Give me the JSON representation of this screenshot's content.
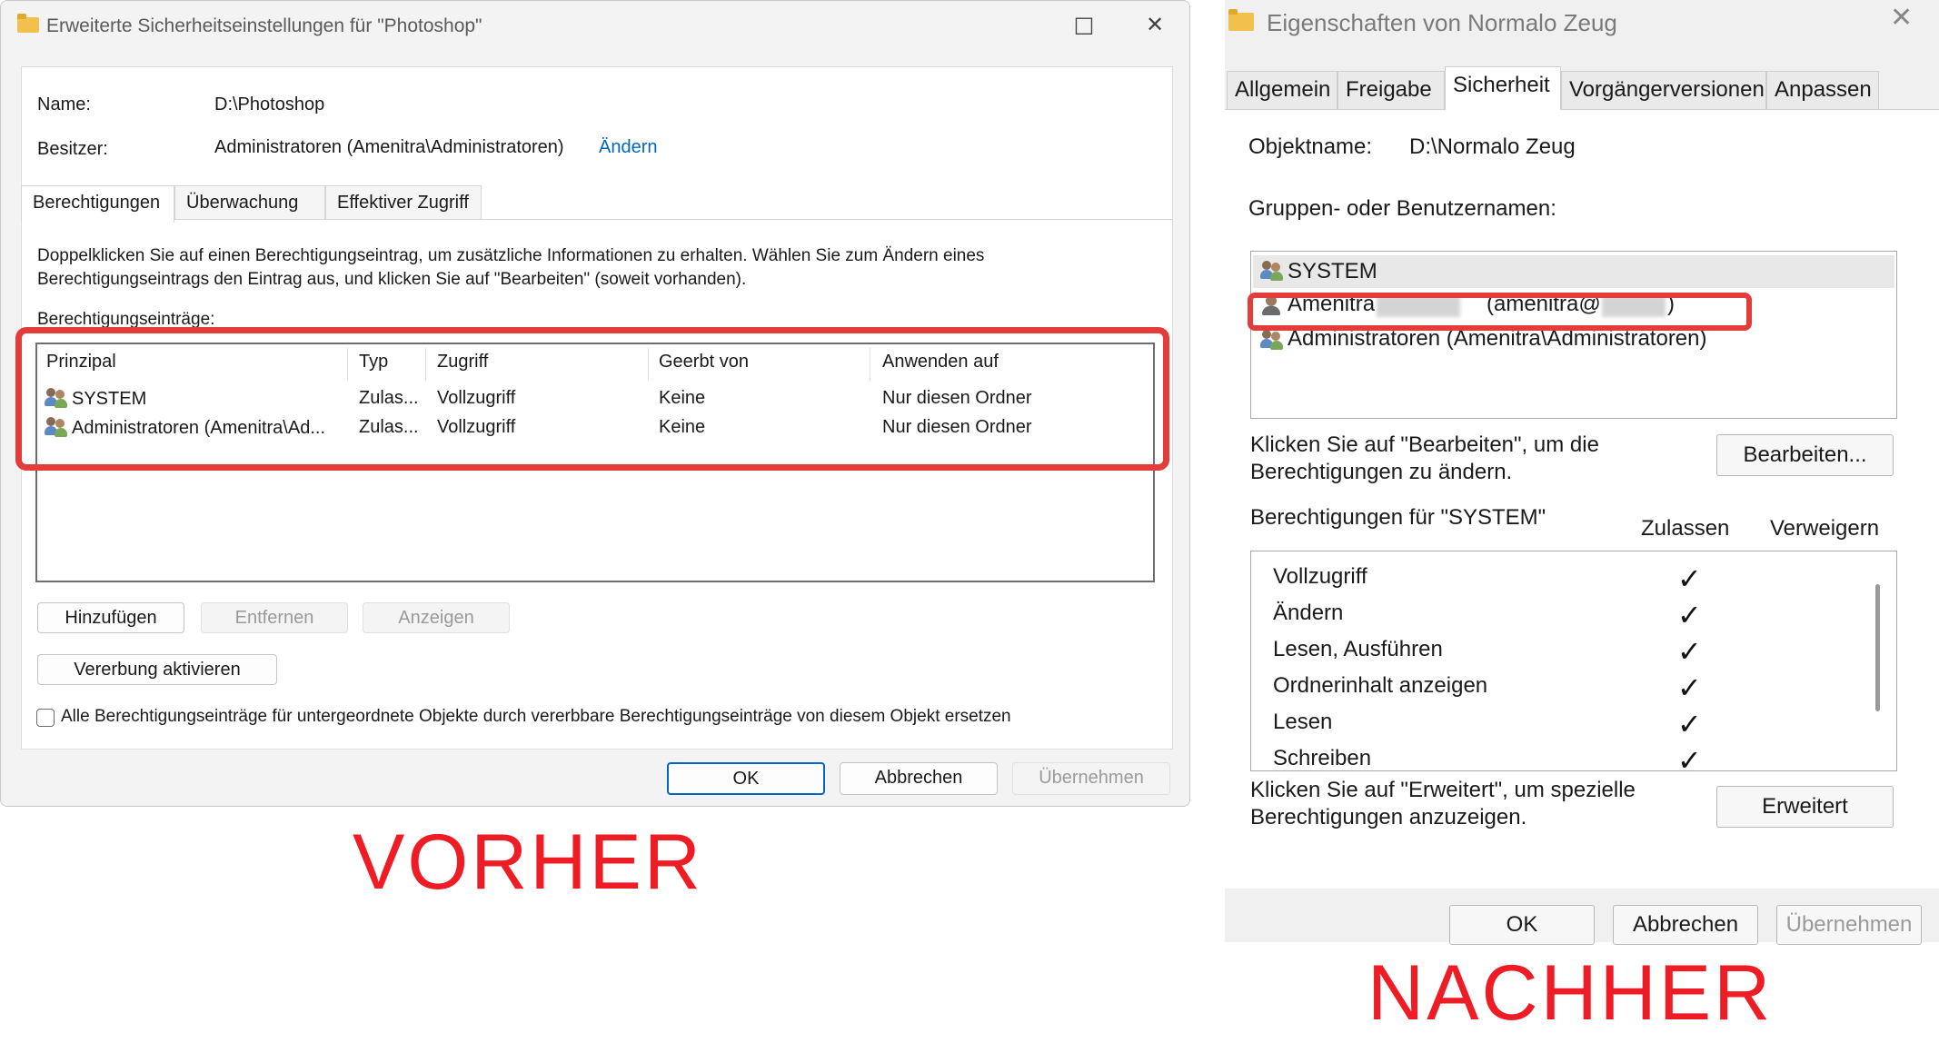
{
  "before": {
    "window": {
      "title": "Erweiterte Sicherheitseinstellungen für \"Photoshop\"",
      "icon": "folder-icon",
      "minimize_glyph": "□",
      "close_glyph": "✕"
    },
    "name": {
      "label": "Name:",
      "value": "D:\\Photoshop"
    },
    "owner": {
      "label": "Besitzer:",
      "value": "Administratoren (Amenitra\\Administratoren)",
      "change_link": "Ändern"
    },
    "tabs": [
      {
        "label": "Berechtigungen",
        "active": true
      },
      {
        "label": "Überwachung",
        "active": false
      },
      {
        "label": "Effektiver Zugriff",
        "active": false
      }
    ],
    "description": [
      "Doppelklicken Sie auf einen Berechtigungseintrag, um zusätzliche Informationen zu erhalten. Wählen Sie zum Ändern eines",
      "Berechtigungseintrags den Eintrag aus, und klicken Sie auf \"Bearbeiten\" (soweit vorhanden)."
    ],
    "entries_label": "Berechtigungseinträge:",
    "columns": [
      "Prinzipal",
      "Typ",
      "Zugriff",
      "Geerbt von",
      "Anwenden auf"
    ],
    "rows": [
      {
        "principal": "SYSTEM",
        "type": "Zulas...",
        "access": "Vollzugriff",
        "inherited": "Keine",
        "applies": "Nur diesen Ordner"
      },
      {
        "principal": "Administratoren (Amenitra\\Ad...",
        "type": "Zulas...",
        "access": "Vollzugriff",
        "inherited": "Keine",
        "applies": "Nur diesen Ordner"
      }
    ],
    "buttons": {
      "add": "Hinzufügen",
      "remove": "Entfernen",
      "view": "Anzeigen",
      "inherit": "Vererbung aktivieren"
    },
    "replace_checkbox": {
      "label": "Alle Berechtigungseinträge für untergeordnete Objekte durch vererbbare Berechtigungseinträge von diesem Objekt ersetzen",
      "checked": false
    },
    "footer": {
      "ok": "OK",
      "cancel": "Abbrechen",
      "apply": "Übernehmen"
    },
    "caption": "VORHER"
  },
  "after": {
    "window": {
      "title": "Eigenschaften von Normalo Zeug",
      "icon": "folder-icon",
      "close_glyph": "✕"
    },
    "tabs": [
      {
        "label": "Allgemein",
        "active": false
      },
      {
        "label": "Freigabe",
        "active": false
      },
      {
        "label": "Sicherheit",
        "active": true
      },
      {
        "label": "Vorgängerversionen",
        "active": false
      },
      {
        "label": "Anpassen",
        "active": false
      }
    ],
    "object": {
      "label": "Objektname:",
      "value": "D:\\Normalo Zeug"
    },
    "groups_label": "Gruppen- oder Benutzernamen:",
    "groups": [
      {
        "name": "SYSTEM",
        "selected": true
      },
      {
        "name_start": "Amenitra",
        "name_middle": "(amenitra@",
        "name_end": ")",
        "redacted": true
      },
      {
        "name": "Administratoren (Amenitra\\Administratoren)"
      }
    ],
    "edit_hint": [
      "Klicken Sie auf \"Bearbeiten\", um die",
      "Berechtigungen zu ändern."
    ],
    "edit_button": "Bearbeiten...",
    "permissions_for": "Berechtigungen für \"SYSTEM\"",
    "allow_header": "Zulassen",
    "deny_header": "Verweigern",
    "permissions": [
      {
        "name": "Vollzugriff",
        "allow": true,
        "deny": false
      },
      {
        "name": "Ändern",
        "allow": true,
        "deny": false
      },
      {
        "name": "Lesen, Ausführen",
        "allow": true,
        "deny": false
      },
      {
        "name": "Ordnerinhalt anzeigen",
        "allow": true,
        "deny": false
      },
      {
        "name": "Lesen",
        "allow": true,
        "deny": false
      },
      {
        "name": "Schreiben",
        "allow": true,
        "deny": false
      }
    ],
    "check_glyph": "✓",
    "advanced_hint": [
      "Klicken Sie auf \"Erweitert\", um spezielle",
      "Berechtigungen anzuzeigen."
    ],
    "advanced_button": "Erweitert",
    "footer": {
      "ok": "OK",
      "cancel": "Abbrechen",
      "apply": "Übernehmen"
    },
    "caption": "NACHHER"
  },
  "colors": {
    "highlight": "#e43b3b",
    "caption": "#ee1c24",
    "link": "#0067c0"
  }
}
